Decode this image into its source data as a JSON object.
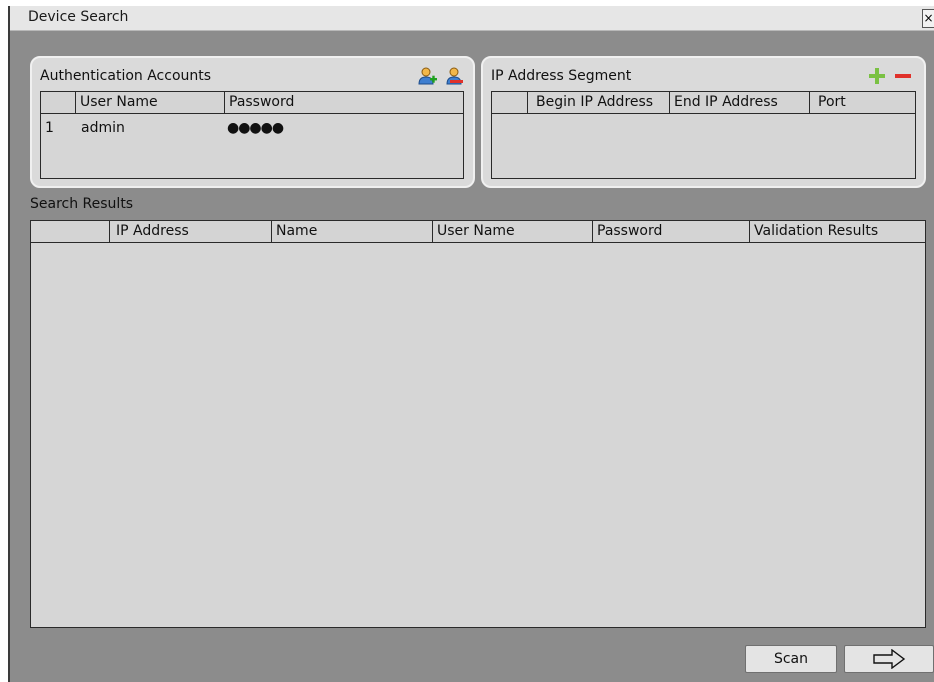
{
  "window": {
    "title": "Device Search",
    "close_glyph": "×"
  },
  "auth": {
    "title": "Authentication Accounts",
    "add_icon": "add-user-icon",
    "remove_icon": "remove-user-icon",
    "columns": [
      "",
      "User Name",
      "Password"
    ],
    "rows": [
      {
        "index": "1",
        "username": "admin",
        "password": "●●●●●"
      }
    ]
  },
  "ip_segment": {
    "title": "IP Address Segment",
    "add_icon": "plus-icon",
    "remove_icon": "minus-icon",
    "columns": [
      "",
      "Begin IP Address",
      "End IP Address",
      "Port"
    ],
    "rows": []
  },
  "results": {
    "title": "Search Results",
    "columns": [
      "",
      "IP Address",
      "Name",
      "User Name",
      "Password",
      "Validation Results"
    ],
    "rows": []
  },
  "buttons": {
    "scan_label": "Scan",
    "next_icon": "arrow-right-icon"
  },
  "colors": {
    "window_bg": "#8c8c8c",
    "panel_bg": "#dadada",
    "plus_green": "#7ac143",
    "minus_red": "#e0312a"
  }
}
